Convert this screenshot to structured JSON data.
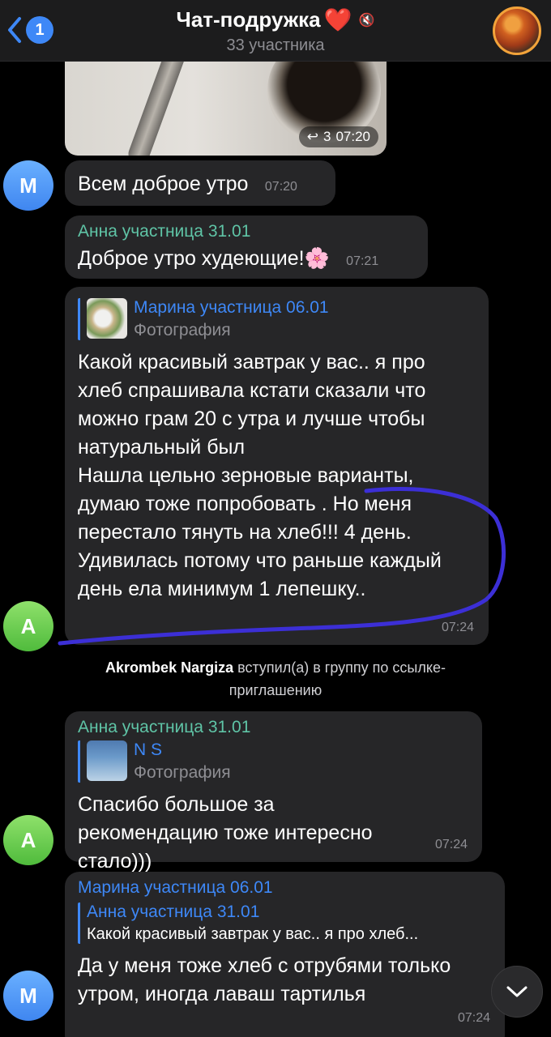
{
  "header": {
    "back_badge": "1",
    "title": "Чат-подружка",
    "title_emoji": "❤️",
    "subtitle": "33 участника"
  },
  "photo_message": {
    "forwards": "3",
    "time": "07:20"
  },
  "messages": [
    {
      "avatar_letter": "М",
      "text": "Всем доброе утро",
      "time": "07:20"
    },
    {
      "sender": "Анна участница 31.01",
      "text": "Доброе утро худеющие!🌸",
      "time": "07:21"
    },
    {
      "avatar_letter": "А",
      "reply": {
        "name": "Марина участница 06.01",
        "sub": "Фотография"
      },
      "text": "Какой красивый завтрак у вас.. я про хлеб спрашивала кстати сказали что можно грам 20 с утра и лучше чтобы натуральный был\nНашла цельно зерновые варианты, думаю тоже попробовать . Но меня перестало тянуть на хлеб!!! 4 день. Удивилась потому что раньше каждый день ела минимум 1 лепешку..",
      "time": "07:24"
    },
    {
      "avatar_letter": "А",
      "sender": "Анна участница 31.01",
      "reply": {
        "name": "N S",
        "sub": "Фотография"
      },
      "text": "Спасибо большое за рекомендацию тоже интересно стало)))",
      "time": "07:24"
    },
    {
      "avatar_letter": "М",
      "sender": "Марина участница 06.01",
      "reply": {
        "name": "Анна участница 31.01",
        "sub": "Какой красивый завтрак у вас.. я про хлеб..."
      },
      "text": "Да у меня тоже хлеб с отрубями только утром, иногда лаваш тартилья",
      "time": "07:24"
    }
  ],
  "service": {
    "name": "Akrombek Nargiza",
    "text": "вступил(а) в группу по ссылке-приглашению"
  },
  "colors": {
    "accent": "#3e88f7",
    "sender_green": "#5fc4a6",
    "bubble": "#262628",
    "annotation_ink": "#3c2fd6"
  }
}
